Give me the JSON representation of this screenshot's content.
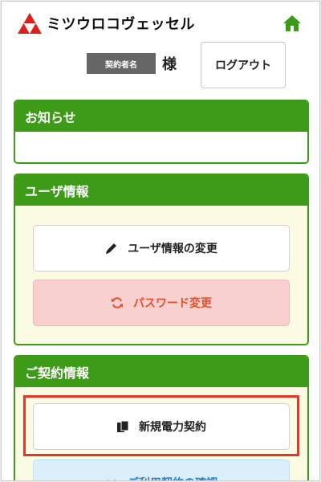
{
  "header": {
    "brand": "ミツウロコヴェッセル",
    "name_badge": "契約者名",
    "honorific": "様",
    "logout_label": "ログアウト"
  },
  "colors": {
    "green": "#3e9b18",
    "logo_red": "#e0201c",
    "highlight": "#e2382b"
  },
  "sections": {
    "notice": {
      "title": "お知らせ"
    },
    "user_info": {
      "title": "ユーザ情報",
      "edit_label": "ユーザ情報の変更",
      "edit_icon": "pencil-icon",
      "password_label": "パスワード変更",
      "password_icon": "refresh-icon"
    },
    "contract": {
      "title": "ご契約情報",
      "new_label": "新規電力契約",
      "new_icon": "documents-icon",
      "confirm_label": "ご利用契約の確認",
      "confirm_icon": "chevron-down-icon"
    }
  }
}
